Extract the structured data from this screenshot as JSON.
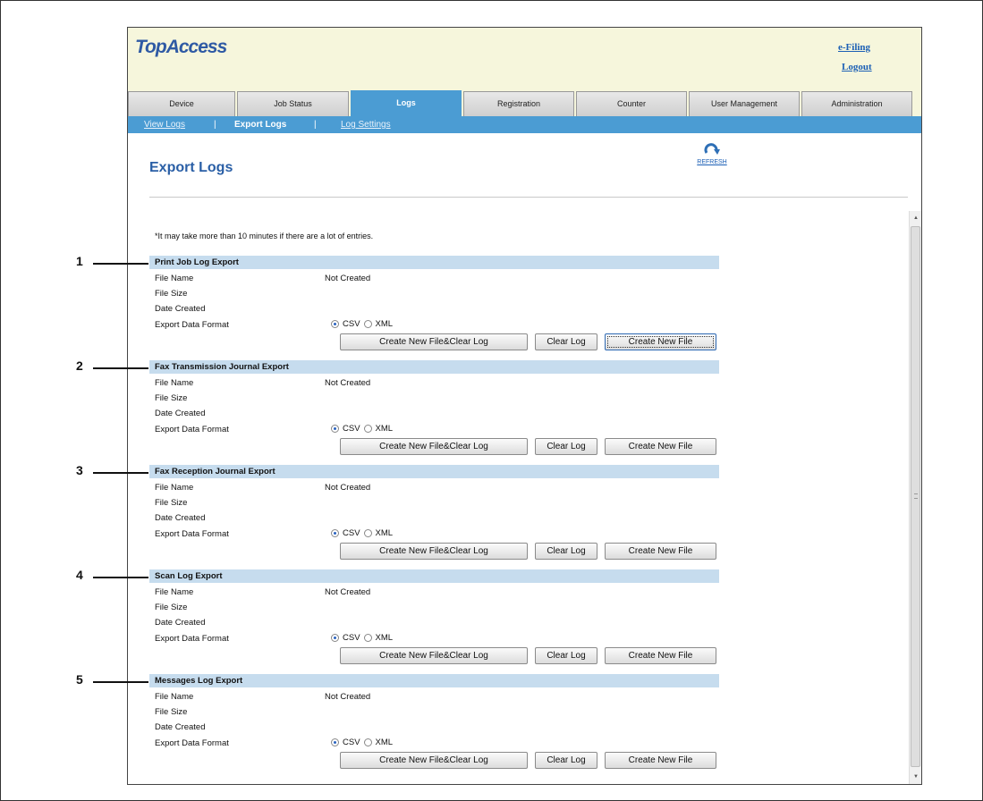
{
  "app": {
    "logo": "TopAccess",
    "links": {
      "efiling": "e-Filing",
      "logout": "Logout"
    }
  },
  "tabs": [
    {
      "label": "Device"
    },
    {
      "label": "Job Status"
    },
    {
      "label": "Logs",
      "active": true
    },
    {
      "label": "Registration"
    },
    {
      "label": "Counter"
    },
    {
      "label": "User Management"
    },
    {
      "label": "Administration"
    }
  ],
  "subnav": {
    "view_logs": "View Logs",
    "export_logs": "Export Logs",
    "log_settings": "Log Settings",
    "separator": "|"
  },
  "page": {
    "title": "Export Logs",
    "refresh_label": "REFRESH",
    "note": "*It may take more than 10 minutes if there are a lot of entries."
  },
  "labels": {
    "file_name": "File Name",
    "file_size": "File Size",
    "date_created": "Date Created",
    "export_format": "Export Data Format",
    "csv": "CSV",
    "xml": "XML",
    "create_clear": "Create New File&Clear Log",
    "clear_log": "Clear Log",
    "create_new": "Create New File"
  },
  "sections": [
    {
      "callout": "1",
      "title": "Print Job Log Export",
      "file_name": "Not Created",
      "format": "CSV"
    },
    {
      "callout": "2",
      "title": "Fax Transmission Journal Export",
      "file_name": "Not Created",
      "format": "CSV"
    },
    {
      "callout": "3",
      "title": "Fax Reception Journal Export",
      "file_name": "Not Created",
      "format": "CSV"
    },
    {
      "callout": "4",
      "title": "Scan Log Export",
      "file_name": "Not Created",
      "format": "CSV"
    },
    {
      "callout": "5",
      "title": "Messages Log Export",
      "file_name": "Not Created",
      "format": "CSV"
    }
  ],
  "colors": {
    "accent": "#4b9cd3",
    "section_header": "#c6dcee",
    "header_bg": "#f6f6dc",
    "title": "#2a5fa6"
  }
}
